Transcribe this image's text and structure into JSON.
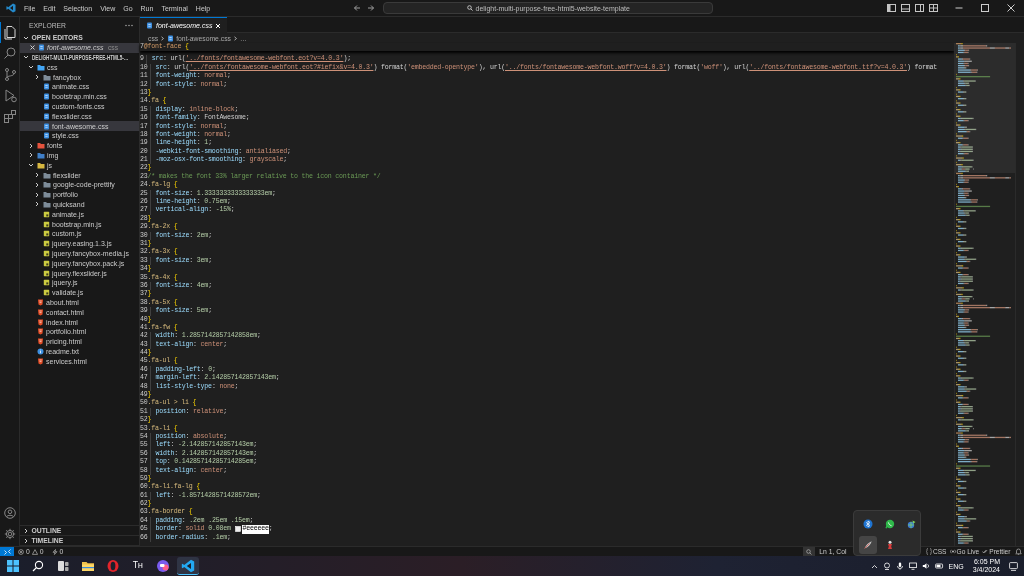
{
  "title_bar": {
    "menu": [
      "File",
      "Edit",
      "Selection",
      "View",
      "Go",
      "Run",
      "Terminal",
      "Help"
    ],
    "search": "delight-multi-purpose-free-html5-website-template"
  },
  "activity_bar": {
    "items": [
      {
        "kind": "explorer",
        "selected": true
      },
      {
        "kind": "search",
        "selected": false
      },
      {
        "kind": "source-control",
        "selected": false
      },
      {
        "kind": "run",
        "selected": false
      },
      {
        "kind": "extensions",
        "selected": false
      }
    ]
  },
  "sidebar": {
    "title": "EXPLORER",
    "open_editors": {
      "title": "OPEN EDITORS",
      "expanded": true,
      "items": [
        {
          "name": "font-awesome.css",
          "folder": "css",
          "kind": "css"
        }
      ]
    },
    "project": {
      "title": "DELIGHT-MULTI-PURPOSE-FREE-HTML5-…",
      "expanded": true,
      "tree": [
        {
          "label": "css",
          "kind": "folder",
          "color": "#42a5f5",
          "expanded": true,
          "selected": false,
          "children": [
            {
              "label": "fancybox",
              "kind": "folder",
              "expanded": false,
              "selected": false
            },
            {
              "label": "animate.css",
              "kind": "css",
              "selected": false
            },
            {
              "label": "bootstrap.min.css",
              "kind": "css",
              "selected": false
            },
            {
              "label": "custom-fonts.css",
              "kind": "css",
              "selected": false
            },
            {
              "label": "flexslider.css",
              "kind": "css",
              "selected": false
            },
            {
              "label": "font-awesome.css",
              "kind": "css",
              "selected": true
            },
            {
              "label": "style.css",
              "kind": "css",
              "selected": false
            }
          ]
        },
        {
          "label": "fonts",
          "kind": "folder",
          "color": "#e5533d",
          "expanded": false,
          "selected": false
        },
        {
          "label": "img",
          "kind": "folder",
          "color": "#3f7fc8",
          "expanded": false,
          "selected": false
        },
        {
          "label": "js",
          "kind": "folder",
          "color": "#d7b740",
          "expanded": true,
          "selected": false,
          "children": [
            {
              "label": "flexslider",
              "kind": "folder",
              "expanded": false,
              "selected": false
            },
            {
              "label": "google-code-prettify",
              "kind": "folder",
              "expanded": false,
              "selected": false
            },
            {
              "label": "portfolio",
              "kind": "folder",
              "expanded": false,
              "selected": false
            },
            {
              "label": "quicksand",
              "kind": "folder",
              "expanded": false,
              "selected": false
            },
            {
              "label": "animate.js",
              "kind": "js",
              "selected": false
            },
            {
              "label": "bootstrap.min.js",
              "kind": "js",
              "selected": false
            },
            {
              "label": "custom.js",
              "kind": "js",
              "selected": false
            },
            {
              "label": "jquery.easing.1.3.js",
              "kind": "js",
              "selected": false
            },
            {
              "label": "jquery.fancybox-media.js",
              "kind": "js",
              "selected": false
            },
            {
              "label": "jquery.fancybox.pack.js",
              "kind": "js",
              "selected": false
            },
            {
              "label": "jquery.flexslider.js",
              "kind": "js",
              "selected": false
            },
            {
              "label": "jquery.js",
              "kind": "js",
              "selected": false
            },
            {
              "label": "validate.js",
              "kind": "js",
              "selected": false
            }
          ]
        },
        {
          "label": "about.html",
          "kind": "html",
          "selected": false
        },
        {
          "label": "contact.html",
          "kind": "html",
          "selected": false
        },
        {
          "label": "index.html",
          "kind": "html",
          "selected": false
        },
        {
          "label": "portfolio.html",
          "kind": "html",
          "selected": false
        },
        {
          "label": "pricing.html",
          "kind": "html",
          "selected": false
        },
        {
          "label": "readme.txt",
          "kind": "txt",
          "selected": false
        },
        {
          "label": "services.html",
          "kind": "html",
          "selected": false
        }
      ]
    },
    "bottom_sections": [
      {
        "title": "OUTLINE",
        "expanded": false
      },
      {
        "title": "TIMELINE",
        "expanded": false
      }
    ]
  },
  "editor": {
    "tabs": [
      {
        "label": "font-awesome.css",
        "kind": "css",
        "selected": true
      }
    ],
    "breadcrumbs": [
      {
        "label": "css",
        "kind": "folder"
      },
      {
        "label": "font-awesome.css",
        "kind": "css"
      },
      {
        "label": "…",
        "kind": "more"
      }
    ],
    "sticky_line": {
      "number": "7",
      "indented": false,
      "tokens": [
        {
          "kind": "at",
          "text": "@font-face"
        },
        {
          "kind": "brace",
          "text": " {"
        }
      ]
    },
    "lines": [
      {
        "number": "9",
        "indented": true,
        "tokens": [
          {
            "kind": "prop",
            "text": "src"
          },
          {
            "kind": "punct",
            "text": ": "
          },
          {
            "kind": "func",
            "text": "url("
          },
          {
            "kind": "link",
            "text": "'../fonts/fontawesome-webfont.eot?v=4.0.3'"
          },
          {
            "kind": "func",
            "text": ")"
          },
          {
            "kind": "punct",
            "text": ";"
          }
        ]
      },
      {
        "number": "10",
        "indented": true,
        "tokens": [
          {
            "kind": "prop",
            "text": "src"
          },
          {
            "kind": "punct",
            "text": ": "
          },
          {
            "kind": "func",
            "text": "url("
          },
          {
            "kind": "link",
            "text": "'../fonts/fontawesome-webfont.eot?#iefix&v=4.0.3'"
          },
          {
            "kind": "func",
            "text": ") format("
          },
          {
            "kind": "string",
            "text": "'embedded-opentype'"
          },
          {
            "kind": "func",
            "text": "), url("
          },
          {
            "kind": "link",
            "text": "'../fonts/fontawesome-webfont.woff?v=4.0.3'"
          },
          {
            "kind": "func",
            "text": ") format("
          },
          {
            "kind": "string",
            "text": "'woff'"
          },
          {
            "kind": "func",
            "text": "), url("
          },
          {
            "kind": "link",
            "text": "'../fonts/fontawesome-webfont.ttf?v=4.0.3'"
          },
          {
            "kind": "func",
            "text": ") format"
          }
        ]
      },
      {
        "number": "11",
        "indented": true,
        "tokens": [
          {
            "kind": "prop",
            "text": "font-weight"
          },
          {
            "kind": "punct",
            "text": ": "
          },
          {
            "kind": "keyword",
            "text": "normal"
          },
          {
            "kind": "punct",
            "text": ";"
          }
        ]
      },
      {
        "number": "12",
        "indented": true,
        "tokens": [
          {
            "kind": "prop",
            "text": "font-style"
          },
          {
            "kind": "punct",
            "text": ": "
          },
          {
            "kind": "keyword",
            "text": "normal"
          },
          {
            "kind": "punct",
            "text": ";"
          }
        ]
      },
      {
        "number": "13",
        "indented": false,
        "tokens": [
          {
            "kind": "brace",
            "text": "}"
          }
        ]
      },
      {
        "number": "14",
        "indented": false,
        "tokens": [
          {
            "kind": "selector",
            "text": ".fa"
          },
          {
            "kind": "brace",
            "text": " {"
          }
        ]
      },
      {
        "number": "15",
        "indented": true,
        "tokens": [
          {
            "kind": "prop",
            "text": "display"
          },
          {
            "kind": "punct",
            "text": ": "
          },
          {
            "kind": "keyword",
            "text": "inline-block"
          },
          {
            "kind": "punct",
            "text": ";"
          }
        ]
      },
      {
        "number": "16",
        "indented": true,
        "tokens": [
          {
            "kind": "prop",
            "text": "font-family"
          },
          {
            "kind": "punct",
            "text": ": FontAwesome;"
          }
        ]
      },
      {
        "number": "17",
        "indented": true,
        "tokens": [
          {
            "kind": "prop",
            "text": "font-style"
          },
          {
            "kind": "punct",
            "text": ": "
          },
          {
            "kind": "keyword",
            "text": "normal"
          },
          {
            "kind": "punct",
            "text": ";"
          }
        ]
      },
      {
        "number": "18",
        "indented": true,
        "tokens": [
          {
            "kind": "prop",
            "text": "font-weight"
          },
          {
            "kind": "punct",
            "text": ": "
          },
          {
            "kind": "keyword",
            "text": "normal"
          },
          {
            "kind": "punct",
            "text": ";"
          }
        ]
      },
      {
        "number": "19",
        "indented": true,
        "tokens": [
          {
            "kind": "prop",
            "text": "line-height"
          },
          {
            "kind": "punct",
            "text": ": "
          },
          {
            "kind": "number",
            "text": "1"
          },
          {
            "kind": "punct",
            "text": ";"
          }
        ]
      },
      {
        "number": "20",
        "indented": true,
        "tokens": [
          {
            "kind": "prop",
            "text": "-webkit-font-smoothing"
          },
          {
            "kind": "punct",
            "text": ": "
          },
          {
            "kind": "keyword",
            "text": "antialiased"
          },
          {
            "kind": "punct",
            "text": ";"
          }
        ]
      },
      {
        "number": "21",
        "indented": true,
        "tokens": [
          {
            "kind": "prop",
            "text": "-moz-osx-font-smoothing"
          },
          {
            "kind": "punct",
            "text": ": "
          },
          {
            "kind": "keyword",
            "text": "grayscale"
          },
          {
            "kind": "punct",
            "text": ";"
          }
        ]
      },
      {
        "number": "22",
        "indented": false,
        "tokens": [
          {
            "kind": "brace",
            "text": "}"
          }
        ]
      },
      {
        "number": "23",
        "indented": false,
        "tokens": [
          {
            "kind": "comment",
            "text": "/* makes the font 33% larger relative to the icon container */"
          }
        ]
      },
      {
        "number": "24",
        "indented": false,
        "tokens": [
          {
            "kind": "selector",
            "text": ".fa-lg"
          },
          {
            "kind": "brace",
            "text": " {"
          }
        ]
      },
      {
        "number": "25",
        "indented": true,
        "tokens": [
          {
            "kind": "prop",
            "text": "font-size"
          },
          {
            "kind": "punct",
            "text": ": "
          },
          {
            "kind": "number",
            "text": "1.3333333333333333em"
          },
          {
            "kind": "punct",
            "text": ";"
          }
        ]
      },
      {
        "number": "26",
        "indented": true,
        "tokens": [
          {
            "kind": "prop",
            "text": "line-height"
          },
          {
            "kind": "punct",
            "text": ": "
          },
          {
            "kind": "number",
            "text": "0.75em"
          },
          {
            "kind": "punct",
            "text": ";"
          }
        ]
      },
      {
        "number": "27",
        "indented": true,
        "tokens": [
          {
            "kind": "prop",
            "text": "vertical-align"
          },
          {
            "kind": "punct",
            "text": ": "
          },
          {
            "kind": "number",
            "text": "-15%"
          },
          {
            "kind": "punct",
            "text": ";"
          }
        ]
      },
      {
        "number": "28",
        "indented": false,
        "tokens": [
          {
            "kind": "brace",
            "text": "}"
          }
        ]
      },
      {
        "number": "29",
        "indented": false,
        "tokens": [
          {
            "kind": "selector",
            "text": ".fa-2x"
          },
          {
            "kind": "brace",
            "text": " {"
          }
        ]
      },
      {
        "number": "30",
        "indented": true,
        "tokens": [
          {
            "kind": "prop",
            "text": "font-size"
          },
          {
            "kind": "punct",
            "text": ": "
          },
          {
            "kind": "number",
            "text": "2em"
          },
          {
            "kind": "punct",
            "text": ";"
          }
        ]
      },
      {
        "number": "31",
        "indented": false,
        "tokens": [
          {
            "kind": "brace",
            "text": "}"
          }
        ]
      },
      {
        "number": "32",
        "indented": false,
        "tokens": [
          {
            "kind": "selector",
            "text": ".fa-3x"
          },
          {
            "kind": "brace",
            "text": " {"
          }
        ]
      },
      {
        "number": "33",
        "indented": true,
        "tokens": [
          {
            "kind": "prop",
            "text": "font-size"
          },
          {
            "kind": "punct",
            "text": ": "
          },
          {
            "kind": "number",
            "text": "3em"
          },
          {
            "kind": "punct",
            "text": ";"
          }
        ]
      },
      {
        "number": "34",
        "indented": false,
        "tokens": [
          {
            "kind": "brace",
            "text": "}"
          }
        ]
      },
      {
        "number": "35",
        "indented": false,
        "tokens": [
          {
            "kind": "selector",
            "text": ".fa-4x"
          },
          {
            "kind": "brace",
            "text": " {"
          }
        ]
      },
      {
        "number": "36",
        "indented": true,
        "tokens": [
          {
            "kind": "prop",
            "text": "font-size"
          },
          {
            "kind": "punct",
            "text": ": "
          },
          {
            "kind": "number",
            "text": "4em"
          },
          {
            "kind": "punct",
            "text": ";"
          }
        ]
      },
      {
        "number": "37",
        "indented": false,
        "tokens": [
          {
            "kind": "brace",
            "text": "}"
          }
        ]
      },
      {
        "number": "38",
        "indented": false,
        "tokens": [
          {
            "kind": "selector",
            "text": ".fa-5x"
          },
          {
            "kind": "brace",
            "text": " {"
          }
        ]
      },
      {
        "number": "39",
        "indented": true,
        "tokens": [
          {
            "kind": "prop",
            "text": "font-size"
          },
          {
            "kind": "punct",
            "text": ": "
          },
          {
            "kind": "number",
            "text": "5em"
          },
          {
            "kind": "punct",
            "text": ";"
          }
        ]
      },
      {
        "number": "40",
        "indented": false,
        "tokens": [
          {
            "kind": "brace",
            "text": "}"
          }
        ]
      },
      {
        "number": "41",
        "indented": false,
        "tokens": [
          {
            "kind": "selector",
            "text": ".fa-fw"
          },
          {
            "kind": "brace",
            "text": " {"
          }
        ]
      },
      {
        "number": "42",
        "indented": true,
        "tokens": [
          {
            "kind": "prop",
            "text": "width"
          },
          {
            "kind": "punct",
            "text": ": "
          },
          {
            "kind": "number",
            "text": "1.2857142857142858em"
          },
          {
            "kind": "punct",
            "text": ";"
          }
        ]
      },
      {
        "number": "43",
        "indented": true,
        "tokens": [
          {
            "kind": "prop",
            "text": "text-align"
          },
          {
            "kind": "punct",
            "text": ": "
          },
          {
            "kind": "keyword",
            "text": "center"
          },
          {
            "kind": "punct",
            "text": ";"
          }
        ]
      },
      {
        "number": "44",
        "indented": false,
        "tokens": [
          {
            "kind": "brace",
            "text": "}"
          }
        ]
      },
      {
        "number": "45",
        "indented": false,
        "tokens": [
          {
            "kind": "selector",
            "text": ".fa-ul"
          },
          {
            "kind": "brace",
            "text": " {"
          }
        ]
      },
      {
        "number": "46",
        "indented": true,
        "tokens": [
          {
            "kind": "prop",
            "text": "padding-left"
          },
          {
            "kind": "punct",
            "text": ": "
          },
          {
            "kind": "number",
            "text": "0"
          },
          {
            "kind": "punct",
            "text": ";"
          }
        ]
      },
      {
        "number": "47",
        "indented": true,
        "tokens": [
          {
            "kind": "prop",
            "text": "margin-left"
          },
          {
            "kind": "punct",
            "text": ": "
          },
          {
            "kind": "number",
            "text": "2.142857142857143em"
          },
          {
            "kind": "punct",
            "text": ";"
          }
        ]
      },
      {
        "number": "48",
        "indented": true,
        "tokens": [
          {
            "kind": "prop",
            "text": "list-style-type"
          },
          {
            "kind": "punct",
            "text": ": "
          },
          {
            "kind": "keyword",
            "text": "none"
          },
          {
            "kind": "punct",
            "text": ";"
          }
        ]
      },
      {
        "number": "49",
        "indented": false,
        "tokens": [
          {
            "kind": "brace",
            "text": "}"
          }
        ]
      },
      {
        "number": "50",
        "indented": false,
        "tokens": [
          {
            "kind": "selector",
            "text": ".fa-ul > li"
          },
          {
            "kind": "brace",
            "text": " {"
          }
        ]
      },
      {
        "number": "51",
        "indented": true,
        "tokens": [
          {
            "kind": "prop",
            "text": "position"
          },
          {
            "kind": "punct",
            "text": ": "
          },
          {
            "kind": "keyword",
            "text": "relative"
          },
          {
            "kind": "punct",
            "text": ";"
          }
        ]
      },
      {
        "number": "52",
        "indented": false,
        "tokens": [
          {
            "kind": "brace",
            "text": "}"
          }
        ]
      },
      {
        "number": "53",
        "indented": false,
        "tokens": [
          {
            "kind": "selector",
            "text": ".fa-li"
          },
          {
            "kind": "brace",
            "text": " {"
          }
        ]
      },
      {
        "number": "54",
        "indented": true,
        "tokens": [
          {
            "kind": "prop",
            "text": "position"
          },
          {
            "kind": "punct",
            "text": ": "
          },
          {
            "kind": "keyword",
            "text": "absolute"
          },
          {
            "kind": "punct",
            "text": ";"
          }
        ]
      },
      {
        "number": "55",
        "indented": true,
        "tokens": [
          {
            "kind": "prop",
            "text": "left"
          },
          {
            "kind": "punct",
            "text": ": "
          },
          {
            "kind": "number",
            "text": "-2.142857142857143em"
          },
          {
            "kind": "punct",
            "text": ";"
          }
        ]
      },
      {
        "number": "56",
        "indented": true,
        "tokens": [
          {
            "kind": "prop",
            "text": "width"
          },
          {
            "kind": "punct",
            "text": ": "
          },
          {
            "kind": "number",
            "text": "2.142857142857143em"
          },
          {
            "kind": "punct",
            "text": ";"
          }
        ]
      },
      {
        "number": "57",
        "indented": true,
        "tokens": [
          {
            "kind": "prop",
            "text": "top"
          },
          {
            "kind": "punct",
            "text": ": "
          },
          {
            "kind": "number",
            "text": "0.14285714285714285em"
          },
          {
            "kind": "punct",
            "text": ";"
          }
        ]
      },
      {
        "number": "58",
        "indented": true,
        "tokens": [
          {
            "kind": "prop",
            "text": "text-align"
          },
          {
            "kind": "punct",
            "text": ": "
          },
          {
            "kind": "keyword",
            "text": "center"
          },
          {
            "kind": "punct",
            "text": ";"
          }
        ]
      },
      {
        "number": "59",
        "indented": false,
        "tokens": [
          {
            "kind": "brace",
            "text": "}"
          }
        ]
      },
      {
        "number": "60",
        "indented": false,
        "tokens": [
          {
            "kind": "selector",
            "text": ".fa-li.fa-lg"
          },
          {
            "kind": "brace",
            "text": " {"
          }
        ]
      },
      {
        "number": "61",
        "indented": true,
        "tokens": [
          {
            "kind": "prop",
            "text": "left"
          },
          {
            "kind": "punct",
            "text": ": "
          },
          {
            "kind": "number",
            "text": "-1.8571428571428572em"
          },
          {
            "kind": "punct",
            "text": ";"
          }
        ]
      },
      {
        "number": "62",
        "indented": false,
        "tokens": [
          {
            "kind": "brace",
            "text": "}"
          }
        ]
      },
      {
        "number": "63",
        "indented": false,
        "tokens": [
          {
            "kind": "selector",
            "text": ".fa-border"
          },
          {
            "kind": "brace",
            "text": " {"
          }
        ]
      },
      {
        "number": "64",
        "indented": true,
        "tokens": [
          {
            "kind": "prop",
            "text": "padding"
          },
          {
            "kind": "punct",
            "text": ": "
          },
          {
            "kind": "number",
            "text": ".2em .25em .15em"
          },
          {
            "kind": "punct",
            "text": ";"
          }
        ]
      },
      {
        "number": "65",
        "indented": true,
        "tokens": [
          {
            "kind": "prop",
            "text": "border"
          },
          {
            "kind": "punct",
            "text": ": "
          },
          {
            "kind": "keyword",
            "text": "solid"
          },
          {
            "kind": "number",
            "text": " 0.08em "
          },
          {
            "kind": "color-selected",
            "text": "#eeeeee"
          },
          {
            "kind": "punct",
            "text": ";"
          }
        ]
      },
      {
        "number": "66",
        "indented": true,
        "tokens": [
          {
            "kind": "prop",
            "text": "border-radius"
          },
          {
            "kind": "punct",
            "text": ": "
          },
          {
            "kind": "number",
            "text": ".1em"
          },
          {
            "kind": "punct",
            "text": ";"
          }
        ]
      }
    ]
  },
  "status_bar": {
    "problems": [
      {
        "kind": "error",
        "count": "0"
      },
      {
        "kind": "warning",
        "count": "0"
      }
    ],
    "ports": "0",
    "position": "Ln 1, Col",
    "items": [
      {
        "kind": "language",
        "label": "CSS"
      },
      {
        "kind": "live",
        "label": "Go Live"
      },
      {
        "kind": "prettier",
        "label": "Prettier"
      }
    ]
  },
  "tray_popup": {
    "items": [
      {
        "kind": "bluetooth",
        "selected": false
      },
      {
        "kind": "chat",
        "selected": false
      },
      {
        "kind": "globe",
        "selected": false
      },
      {
        "kind": "feather",
        "selected": true
      },
      {
        "kind": "figure",
        "selected": false
      }
    ]
  },
  "taskbar": {
    "apps": [
      {
        "kind": "start",
        "selected": false
      },
      {
        "kind": "search",
        "selected": false
      },
      {
        "kind": "task-view",
        "selected": false
      },
      {
        "kind": "files",
        "selected": false
      },
      {
        "kind": "ring",
        "selected": false
      },
      {
        "kind": "text-app",
        "label": "Tн",
        "selected": false
      },
      {
        "kind": "chat-app",
        "selected": false
      },
      {
        "kind": "editor-app",
        "selected": true
      }
    ],
    "language": "ENG",
    "time": "6:05 PM",
    "date": "3/4/2024"
  }
}
